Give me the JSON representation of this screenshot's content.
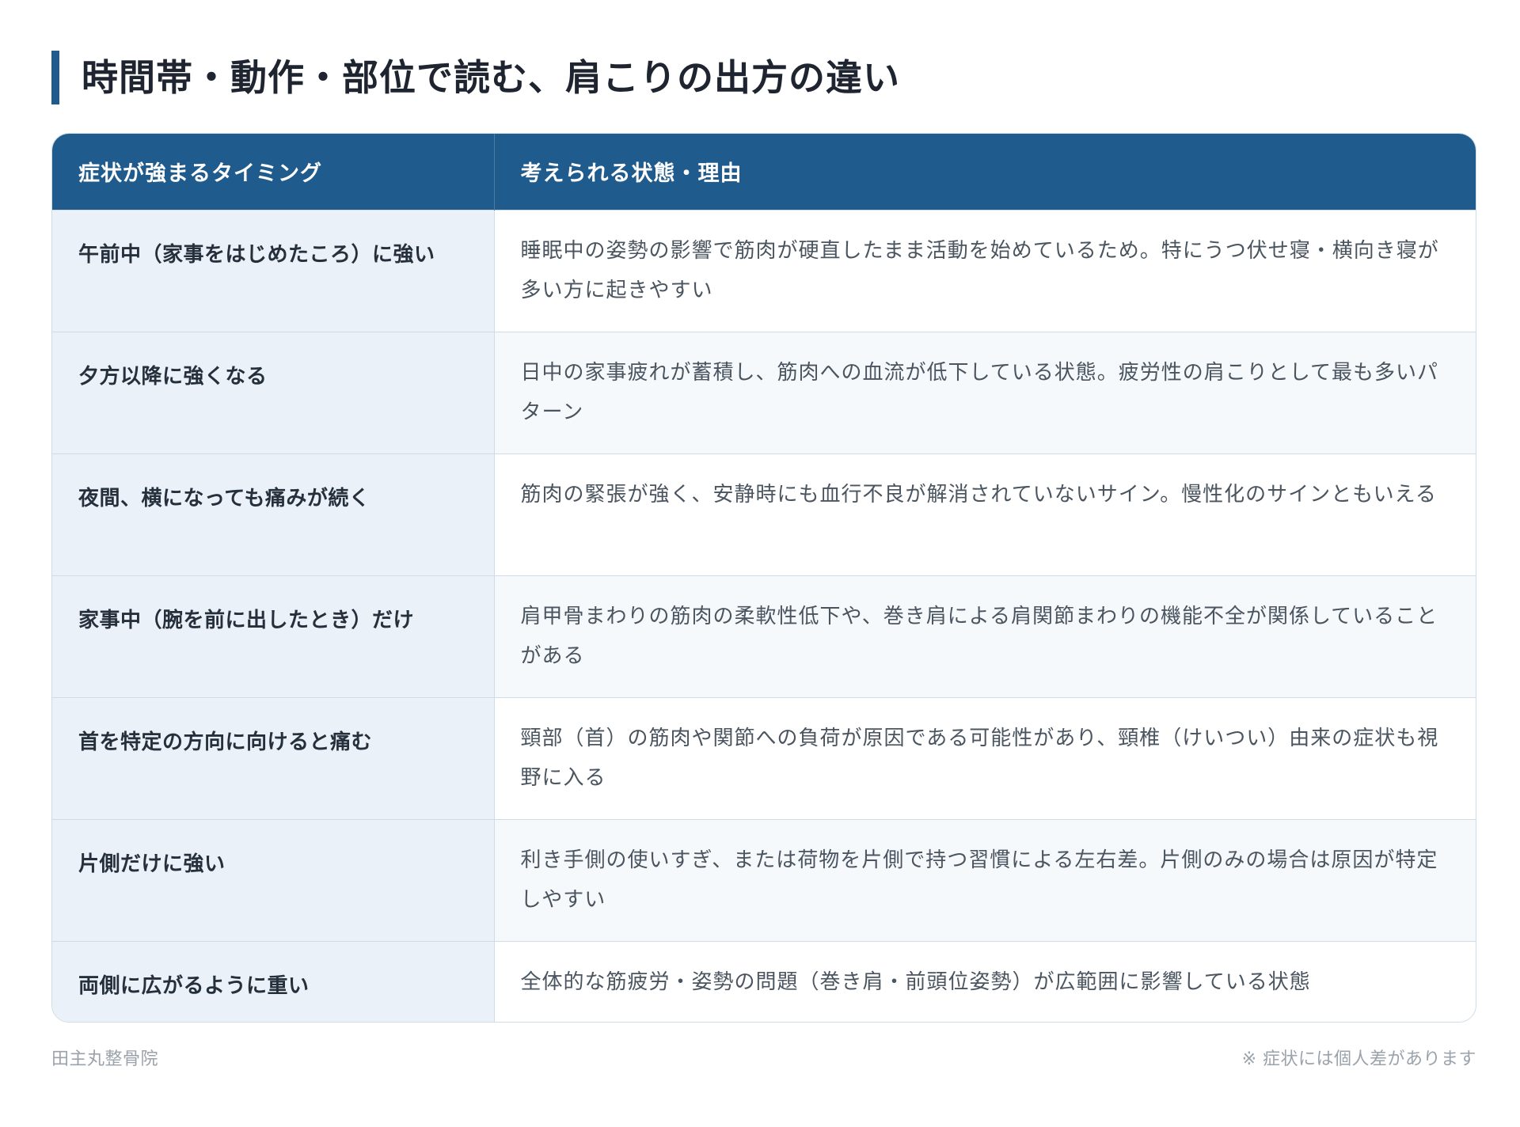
{
  "title": "時間帯・動作・部位で読む、肩こりの出方の違い",
  "table": {
    "headers": [
      "症状が強まるタイミング",
      "考えられる状態・理由"
    ],
    "rows": [
      {
        "timing": "午前中（家事をはじめたころ）に強い",
        "reason": "睡眠中の姿勢の影響で筋肉が硬直したまま活動を始めているため。特にうつ伏せ寝・横向き寝が多い方に起きやすい"
      },
      {
        "timing": "夕方以降に強くなる",
        "reason": "日中の家事疲れが蓄積し、筋肉への血流が低下している状態。疲労性の肩こりとして最も多いパターン"
      },
      {
        "timing": "夜間、横になっても痛みが続く",
        "reason": "筋肉の緊張が強く、安静時にも血行不良が解消されていないサイン。慢性化のサインともいえる"
      },
      {
        "timing": "家事中（腕を前に出したとき）だけ",
        "reason": "肩甲骨まわりの筋肉の柔軟性低下や、巻き肩による肩関節まわりの機能不全が関係していることがある"
      },
      {
        "timing": "首を特定の方向に向けると痛む",
        "reason": "頸部（首）の筋肉や関節への負荷が原因である可能性があり、頸椎（けいつい）由来の症状も視野に入る"
      },
      {
        "timing": "片側だけに強い",
        "reason": "利き手側の使いすぎ、または荷物を片側で持つ習慣による左右差。片側のみの場合は原因が特定しやすい"
      },
      {
        "timing": "両側に広がるように重い",
        "reason": "全体的な筋疲労・姿勢の問題（巻き肩・前頭位姿勢）が広範囲に影響している状態"
      }
    ]
  },
  "footer": {
    "clinic": "田主丸整骨院",
    "note": "※ 症状には個人差があります"
  },
  "colors": {
    "accent": "#1f5b8c",
    "row_label_bg": "#eaf1f8"
  }
}
